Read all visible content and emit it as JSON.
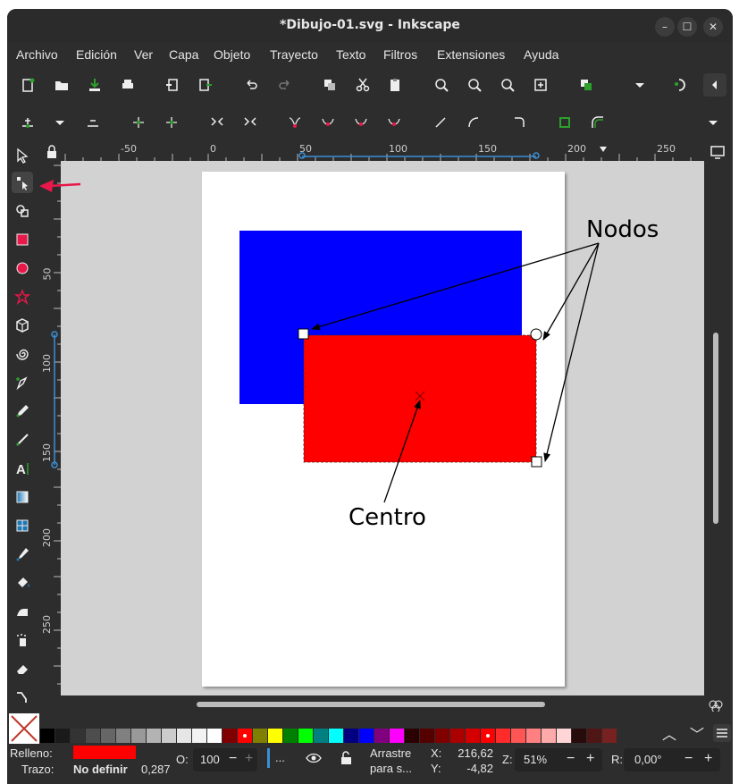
{
  "window": {
    "title": "*Dibujo-01.svg - Inkscape",
    "minimize": "–",
    "maximize": "☐",
    "close": "✕"
  },
  "menu": [
    "Archivo",
    "Edición",
    "Ver",
    "Capa",
    "Objeto",
    "Trayecto",
    "Texto",
    "Filtros",
    "Extensiones",
    "Ayuda"
  ],
  "ruler_top": [
    "-50",
    "0",
    "50",
    "100",
    "150",
    "200",
    "250"
  ],
  "ruler_left": [
    "50",
    "100",
    "150",
    "200",
    "250"
  ],
  "annotations": {
    "nodos": "Nodos",
    "centro": "Centro"
  },
  "colors": {
    "blue_rect": "#0000ff",
    "red_rect": "#ff0000",
    "arrow": "#e8184a",
    "fill_swatch": "#ff0000"
  },
  "palette_colors": [
    "#000000",
    "#1a1a1a",
    "#333333",
    "#4d4d4d",
    "#666666",
    "#808080",
    "#999999",
    "#b3b3b3",
    "#cccccc",
    "#e6e6e6",
    "#f2f2f2",
    "#ffffff",
    "#800000",
    "#ff0000",
    "#808000",
    "#ffff00",
    "#008000",
    "#00ff00",
    "#008080",
    "#00ffff",
    "#000080",
    "#0000ff",
    "#800080",
    "#ff00ff",
    "#2b0000",
    "#550000",
    "#800000",
    "#aa0000",
    "#d40000",
    "#ff0000",
    "#ff2a2a",
    "#ff5555",
    "#ff8080",
    "#ffaaaa",
    "#ffd5d5",
    "#280b0b",
    "#501616",
    "#782121"
  ],
  "status": {
    "fill_label": "Relleno:",
    "stroke_label": "Trazo:",
    "stroke_value": "No definir",
    "stroke_width": "0,287",
    "opacity_label": "O:",
    "opacity_value": "100",
    "minus": "−",
    "plus": "+",
    "layer_dots": "...",
    "message_line1": "Arrastre",
    "message_line2": "para s...",
    "x_label": "X:",
    "x_value": "216,62",
    "y_label": "Y:",
    "y_value": "-4,82",
    "zoom_label": "Z:",
    "zoom_value": "51%",
    "rotation_label": "R:",
    "rotation_value": "0,00°"
  }
}
